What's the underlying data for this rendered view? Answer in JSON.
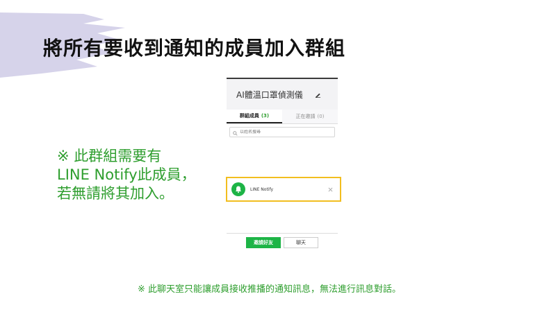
{
  "title": "將所有要收到通知的成員加入群組",
  "note": {
    "line1": "※ 此群組需要有",
    "line2": "LINE Notify此成員，",
    "line3": "若無請將其加入。"
  },
  "panel": {
    "group_name": "AI體溫口罩偵測儀",
    "tabs": [
      {
        "label": "群組成員",
        "count": "(3)"
      },
      {
        "label": "正在邀請",
        "count": "(0)"
      }
    ],
    "search_placeholder": "以姓名搜尋",
    "member": {
      "name": "LINE Notify"
    },
    "invite_button": "邀請好友",
    "chat_button": "聊天"
  },
  "footnote": "※ 此聊天室只能讓成員接收推播的通知訊息，無法進行訊息對話。",
  "colors": {
    "accent_green": "#2e9e2e",
    "line_green": "#1db446",
    "highlight": "#f2be1f",
    "brush": "#d6d3ea"
  },
  "icons": [
    "edit-icon",
    "search-icon",
    "bell-icon",
    "close-icon"
  ]
}
